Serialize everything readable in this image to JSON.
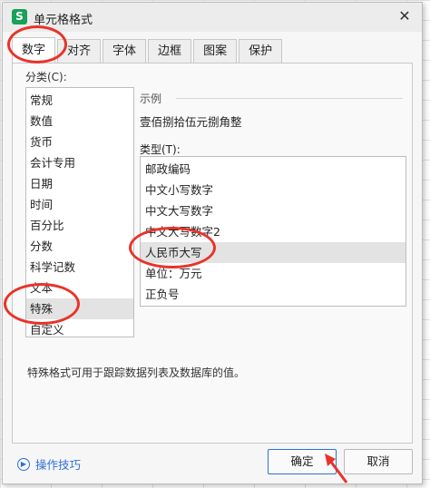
{
  "window": {
    "title": "单元格格式",
    "app_icon_letter": "S",
    "close_glyph": "✕"
  },
  "tabs": [
    {
      "label": "数字",
      "active": true
    },
    {
      "label": "对齐",
      "active": false
    },
    {
      "label": "字体",
      "active": false
    },
    {
      "label": "边框",
      "active": false
    },
    {
      "label": "图案",
      "active": false
    },
    {
      "label": "保护",
      "active": false
    }
  ],
  "category": {
    "label": "分类(C):",
    "items": [
      "常规",
      "数值",
      "货币",
      "会计专用",
      "日期",
      "时间",
      "百分比",
      "分数",
      "科学记数",
      "文本",
      "特殊",
      "自定义"
    ],
    "selected": "特殊"
  },
  "preview": {
    "label": "示例",
    "value": "壹佰捌拾伍元捌角整"
  },
  "type": {
    "label": "类型(T):",
    "items": [
      "邮政编码",
      "中文小写数字",
      "中文大写数字",
      "中文大写数字2",
      "人民币大写",
      "单位：万元",
      "正负号"
    ],
    "selected": "人民币大写"
  },
  "description": "特殊格式可用于跟踪数据列表及数据库的值。",
  "footer": {
    "tips_label": "操作技巧",
    "tips_icon": "play-circle-icon",
    "ok_label": "确定",
    "cancel_label": "取消"
  },
  "colors": {
    "annotation_red": "#e8332a",
    "accent_blue": "#2f6fd6",
    "app_green": "#19a05a",
    "selection_gray": "#e3e3e3"
  }
}
